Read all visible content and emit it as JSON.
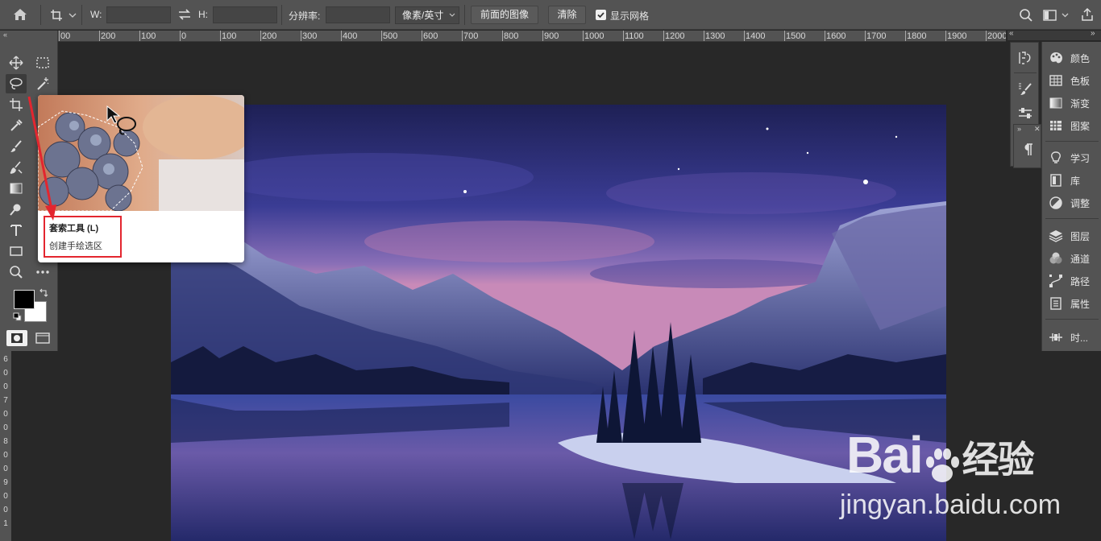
{
  "options_bar": {
    "home_icon": "home-icon",
    "transform_icon": "crop-transform-icon",
    "width_label": "W:",
    "width_value": "",
    "swap_icon": "swap-icon",
    "height_label": "H:",
    "height_value": "",
    "resolution_label": "分辨率:",
    "resolution_value": "",
    "unit_select": "像素/英寸",
    "front_image_button": "前面的图像",
    "clear_button": "清除",
    "show_grid_label": "显示网格",
    "show_grid_checked": true,
    "search_icon": "search-icon",
    "workspace_icon": "workspace-icon",
    "share_icon": "share-icon"
  },
  "ruler": {
    "top_labels": [
      "00",
      "200",
      "100",
      "0",
      "100",
      "200",
      "300",
      "400",
      "500",
      "600",
      "700",
      "800",
      "900",
      "1000",
      "1100",
      "1200",
      "1300",
      "1400",
      "1500",
      "1600",
      "1700",
      "1800",
      "1900",
      "2000"
    ],
    "left_labels": [
      "6",
      "0",
      "0",
      "7",
      "0",
      "0",
      "8",
      "0",
      "0",
      "9",
      "0",
      "0",
      "1"
    ]
  },
  "tools": [
    {
      "name": "move-tool",
      "icon": "move-icon"
    },
    {
      "name": "marquee-tool",
      "icon": "rect-marquee-icon"
    },
    {
      "name": "lasso-tool",
      "icon": "lasso-icon"
    },
    {
      "name": "magic-wand-tool",
      "icon": "magic-wand-icon"
    },
    {
      "name": "crop-tool",
      "icon": "crop-icon"
    },
    {
      "name": "eyedropper-tool",
      "icon": "eyedropper-icon"
    },
    {
      "name": "brush-tool",
      "icon": "brush-icon"
    },
    {
      "name": "clone-stamp-tool",
      "icon": "clone-icon"
    },
    {
      "name": "gradient-tool",
      "icon": "gradient-icon"
    },
    {
      "name": "dodge-tool",
      "icon": "dodge-icon"
    },
    {
      "name": "type-tool",
      "icon": "type-icon"
    },
    {
      "name": "shape-tool",
      "icon": "rectangle-icon"
    },
    {
      "name": "zoom-tool",
      "icon": "zoom-icon"
    },
    {
      "name": "more-tools",
      "icon": "ellipsis-icon"
    }
  ],
  "tooltip": {
    "title": "套索工具 (L)",
    "description": "创建手绘选区"
  },
  "right_panel": {
    "items": [
      {
        "label": "颜色",
        "icon": "color-icon"
      },
      {
        "label": "色板",
        "icon": "swatches-icon"
      },
      {
        "label": "渐变",
        "icon": "gradient-icon"
      },
      {
        "label": "图案",
        "icon": "pattern-icon"
      },
      {
        "label": "学习",
        "icon": "learn-icon"
      },
      {
        "label": "库",
        "icon": "library-icon"
      },
      {
        "label": "调整",
        "icon": "adjustments-icon"
      },
      {
        "label": "图层",
        "icon": "layers-icon"
      },
      {
        "label": "通道",
        "icon": "channels-icon"
      },
      {
        "label": "路径",
        "icon": "paths-icon"
      },
      {
        "label": "属性",
        "icon": "properties-icon"
      },
      {
        "label": "时...",
        "icon": "timeline-icon"
      }
    ]
  },
  "watermark": {
    "brand": "Bai",
    "brand_suffix": "经验",
    "url": "jingyan.baidu.com"
  },
  "colors": {
    "panel_bg": "#535353",
    "canvas_bg": "#282828",
    "annotation_red": "#e3262f"
  }
}
